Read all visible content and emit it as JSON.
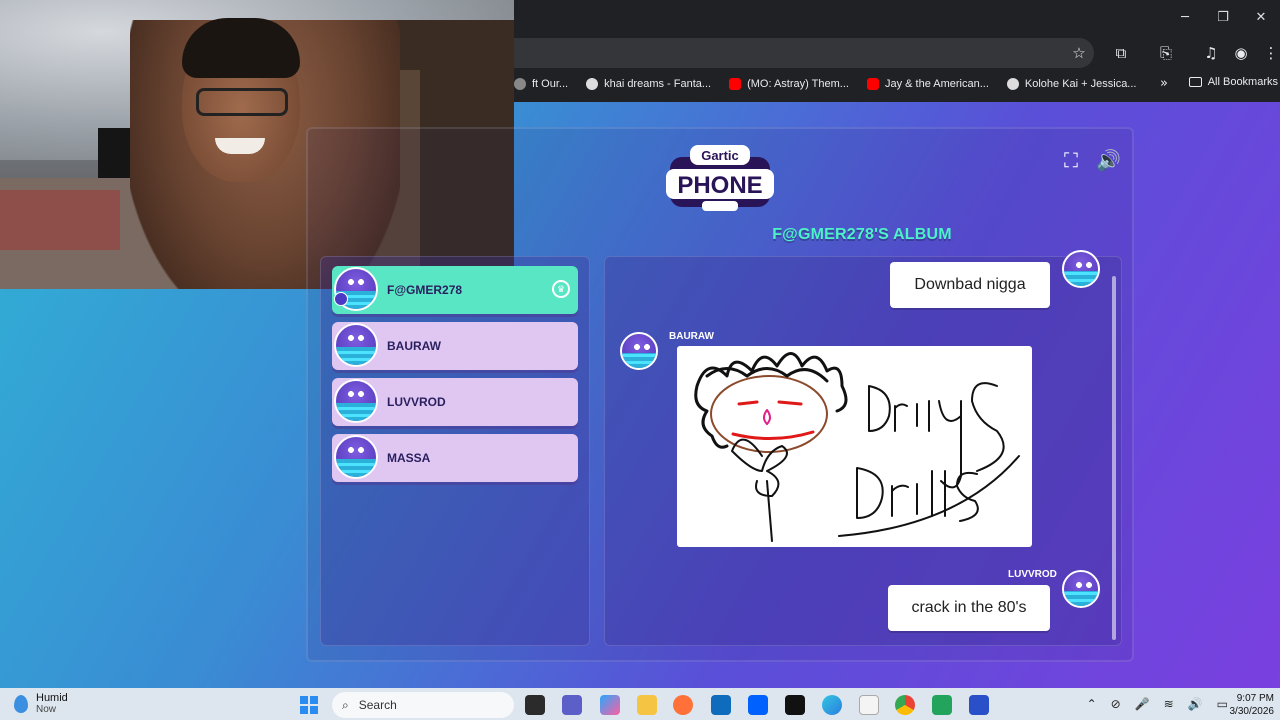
{
  "bookmarks": [
    {
      "label": "ft Our...",
      "color": "#888888"
    },
    {
      "label": "khai dreams - Fanta...",
      "color": "#dddddd"
    },
    {
      "label": "(MO: Astray) Them...",
      "color": "#ff0000"
    },
    {
      "label": "Jay & the American...",
      "color": "#ff0000"
    },
    {
      "label": "Kolohe Kai + Jessica...",
      "color": "#dddddd"
    }
  ],
  "bookmarks_more": "»",
  "all_bookmarks": "All Bookmarks",
  "window_controls": {
    "minimize": "─",
    "restore": "❐",
    "close": "✕"
  },
  "toolbar_icons": {
    "star": "☆",
    "extensions": "⧉",
    "cast": "⎘",
    "media": "♫",
    "profile": "◉",
    "menu": "⋮"
  },
  "game": {
    "logo_top": "Gartic",
    "logo_bottom": "PHONE",
    "album_title": "F@GMER278'S ALBUM",
    "fullscreen_icon": "⛶",
    "sound_icon": "🔊",
    "players": [
      {
        "name": "F@GMER278",
        "active": true
      },
      {
        "name": "BAURAW",
        "active": false
      },
      {
        "name": "LUVVROD",
        "active": false
      },
      {
        "name": "MASSA",
        "active": false
      }
    ],
    "crown_icon": "♛",
    "album": {
      "msg1": "Downbad nigga",
      "drawing_author": "BAURAW",
      "msg2_author": "LUVVROD",
      "msg2": "crack in the 80's"
    }
  },
  "taskbar": {
    "weather_title": "Humid",
    "weather_sub": "Now",
    "search_label": "Search",
    "search_icon": "⌕",
    "time": "9:07 PM",
    "date": "3/30/2026",
    "tray": [
      "⌃",
      "⊘",
      "🎤",
      "≋",
      "🔊",
      "▭"
    ]
  }
}
